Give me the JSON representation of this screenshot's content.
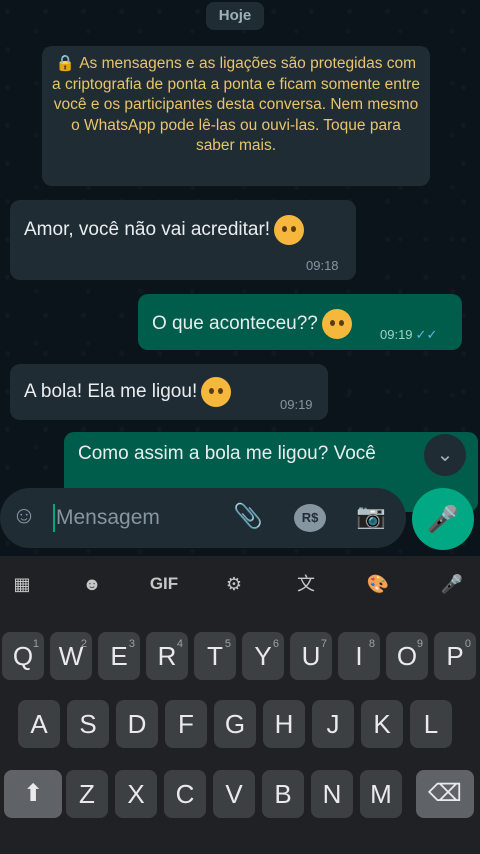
{
  "chat": {
    "date_chip": "Hoje",
    "encryption_notice": "As mensagens e as ligações são protegidas com a criptografia de ponta a ponta e ficam somente entre você e os participantes desta conversa. Nem mesmo o WhatsApp pode lê-las ou ouvi-las. Toque para saber mais.",
    "messages": [
      {
        "direction": "in",
        "text": "Amor, você não vai acreditar!",
        "time": "09:18",
        "emoji": "face-screaming-emoji"
      },
      {
        "direction": "out",
        "text": "O que aconteceu??",
        "time": "09:19",
        "emoji": "face-with-monocle-emoji",
        "status": "read"
      },
      {
        "direction": "in",
        "text": "A bola! Ela me ligou!",
        "time": "09:19",
        "emoji": "flushed-face-emoji"
      },
      {
        "direction": "out",
        "text": "Como assim a bola me ligou? Você",
        "time": "",
        "emoji": ""
      }
    ]
  },
  "composer": {
    "placeholder": "Mensagem",
    "icons": [
      "emoji-icon",
      "attach-icon",
      "payment-icon",
      "camera-icon",
      "mic-icon"
    ]
  },
  "keyboard": {
    "toolbar": [
      "apps-grid-icon",
      "sticker-icon",
      "GIF",
      "settings-gear-icon",
      "translate-icon",
      "palette-icon",
      "mic-icon"
    ],
    "gif_label": "GIF",
    "row1": [
      "Q",
      "W",
      "E",
      "R",
      "T",
      "Y",
      "U",
      "I",
      "O",
      "P"
    ],
    "row1_hints": [
      "1",
      "2",
      "3",
      "4",
      "5",
      "6",
      "7",
      "8",
      "9",
      "0"
    ],
    "row2": [
      "A",
      "S",
      "D",
      "F",
      "G",
      "H",
      "J",
      "K",
      "L"
    ],
    "row3": [
      "Z",
      "X",
      "C",
      "V",
      "B",
      "N",
      "M"
    ],
    "shift_icon": "shift-icon",
    "backspace_icon": "backspace-icon"
  },
  "colors": {
    "chat_bg": "#0b141a",
    "incoming_bubble": "#1f2c34",
    "outgoing_bubble": "#005c4b",
    "accent": "#00a884",
    "notice_text": "#e9c46a",
    "keyboard_bg": "#202124",
    "key_bg": "#3c4043"
  }
}
